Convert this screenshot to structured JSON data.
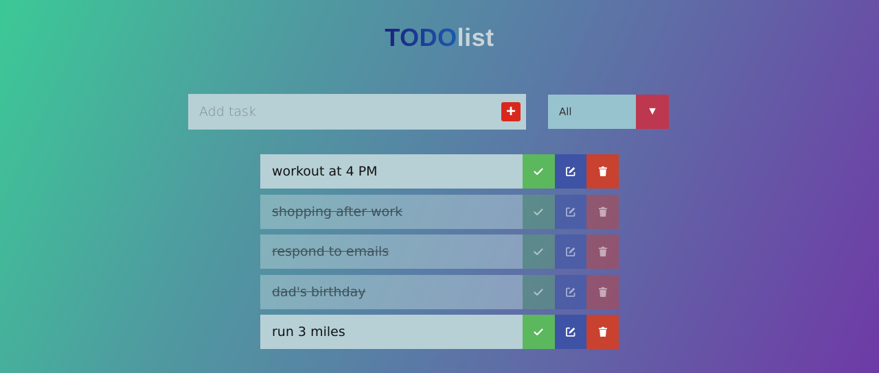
{
  "header": {
    "title_bold": "TODO",
    "title_light": "list"
  },
  "add_task": {
    "placeholder": "Add task",
    "add_icon": "plus-icon"
  },
  "filter": {
    "selected": "All",
    "arrow": "▼"
  },
  "tasks": [
    {
      "text": "workout at 4 PM",
      "completed": false
    },
    {
      "text": "shopping after work",
      "completed": true
    },
    {
      "text": "respond to emails",
      "completed": true
    },
    {
      "text": "dad's birthday",
      "completed": true
    },
    {
      "text": "run 3 miles",
      "completed": false
    }
  ],
  "colors": {
    "complete": "#5cb85c",
    "edit": "#3e53a5",
    "delete": "#c9412f",
    "add": "#d9271d",
    "dropdown_arrow_bg": "#bd384f"
  }
}
